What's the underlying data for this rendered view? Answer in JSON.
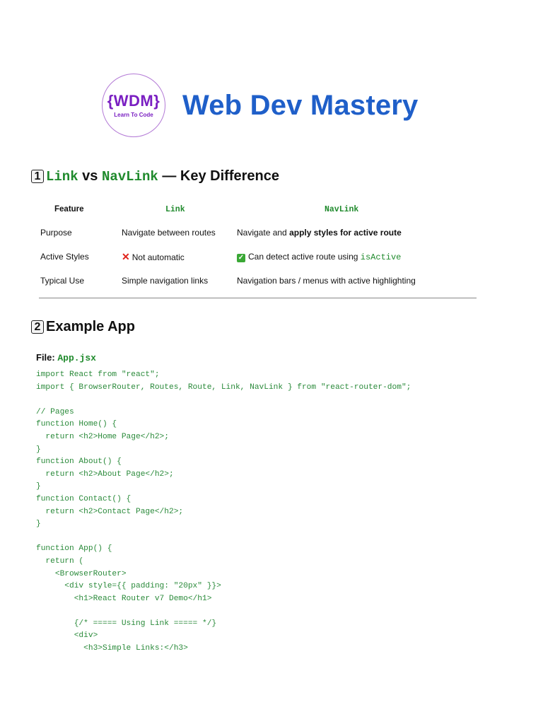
{
  "header": {
    "logo_brace_open": "{",
    "logo_text": "WDM",
    "logo_brace_close": "}",
    "logo_tagline": "Learn To Code",
    "title": "Web Dev Mastery"
  },
  "section1": {
    "number": "1",
    "link_word": "Link",
    "vs": " vs ",
    "navlink_word": "NavLink",
    "rest": " — Key Difference"
  },
  "table": {
    "headers": [
      "Feature",
      "Link",
      "NavLink"
    ],
    "rows": [
      {
        "feature": "Purpose",
        "link": "Navigate between routes",
        "navlink_prefix": "Navigate and ",
        "navlink_bold": "apply styles for active route"
      },
      {
        "feature": "Active Styles",
        "link": "Not automatic",
        "navlink_prefix": "Can detect active route using ",
        "navlink_code": "isActive"
      },
      {
        "feature": "Typical Use",
        "link": "Simple navigation links",
        "navlink_prefix": "Navigation bars / menus with active highlighting"
      }
    ]
  },
  "section2": {
    "number": "2",
    "title": "Example App"
  },
  "file": {
    "label": "File: ",
    "name": "App.jsx"
  },
  "code": "import React from \"react\";\nimport { BrowserRouter, Routes, Route, Link, NavLink } from \"react-router-dom\";\n\n// Pages\nfunction Home() {\n  return <h2>Home Page</h2>;\n}\nfunction About() {\n  return <h2>About Page</h2>;\n}\nfunction Contact() {\n  return <h2>Contact Page</h2>;\n}\n\nfunction App() {\n  return (\n    <BrowserRouter>\n      <div style={{ padding: \"20px\" }}>\n        <h1>React Router v7 Demo</h1>\n\n        {/* ===== Using Link ===== */}\n        <div>\n          <h3>Simple Links:</h3>",
  "colors": {
    "title_blue": "#1f5fc9",
    "logo_purple": "#7a1fc2",
    "code_green": "#1f8a2c"
  }
}
